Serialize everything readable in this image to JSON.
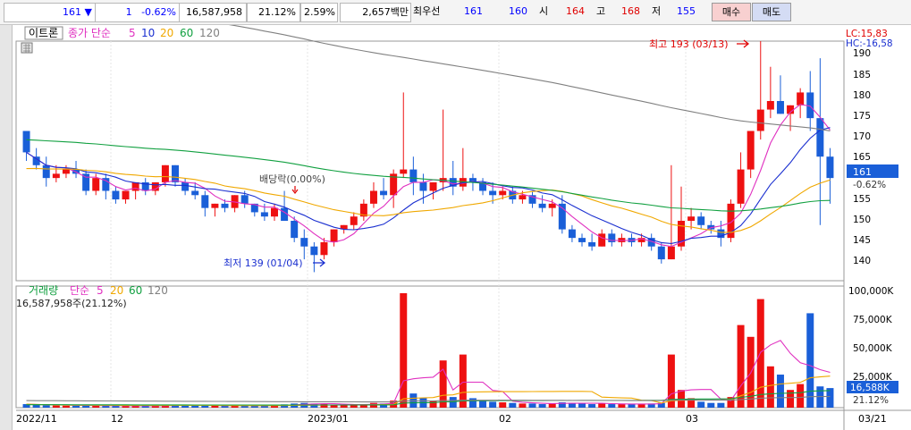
{
  "quote": {
    "price": "161",
    "direction_icon": "down-triangle",
    "change": "1",
    "change_pct": "-0.62%",
    "volume": "16,587,958",
    "volume_ratio": "21.12%",
    "turnover": "2.59%",
    "amount": "2,657백만",
    "hoga_label": "최우선",
    "ask": "161",
    "bid": "160",
    "open_label": "시",
    "open": "164",
    "high_label": "고",
    "high": "168",
    "low_label": "저",
    "low": "155",
    "buy_label": "매수",
    "sell_label": "매도"
  },
  "legend": {
    "item": "이트론",
    "price_ma_label": "종가 단순",
    "ma_periods": [
      "5",
      "10",
      "20",
      "60",
      "120"
    ],
    "volume_label": "거래량",
    "volume_ma_label": "단순",
    "volume_periods": [
      "5",
      "20",
      "60",
      "120"
    ],
    "volume_value": "16,587,958주(21.12%)"
  },
  "colors": {
    "up": "#ee1111",
    "down": "#1a5fd8",
    "ma5": "#e030c0",
    "ma10": "#1a2fd0",
    "ma20": "#f0a800",
    "ma60": "#11a040",
    "ma120": "#808080"
  },
  "annotations": {
    "high": "최고 193 (03/13)",
    "low": "최저 139 (01/04)",
    "dividend": "배당락(0.00%)"
  },
  "right_labels": {
    "lc": "LC:15,83",
    "hc": "HC:-16,58",
    "current_price": "161",
    "current_pct": "-0.62%",
    "current_volume": "16,588K",
    "volume_pct": "21.12%"
  },
  "price_axis": {
    "ticks": [
      "190",
      "185",
      "180",
      "175",
      "170",
      "165",
      "155",
      "150",
      "145",
      "140"
    ]
  },
  "volume_axis": {
    "ticks": [
      "100,000K",
      "75,000K",
      "50,000K",
      "25,000K"
    ]
  },
  "x_axis": {
    "labels": [
      "2022/11",
      "12",
      "2023/01",
      "02",
      "03",
      "03/21"
    ]
  },
  "chart_data": {
    "type": "candlestick",
    "ohlc": [
      [
        172,
        172,
        165,
        167
      ],
      [
        166,
        168,
        163,
        164
      ],
      [
        164,
        166,
        159,
        161
      ],
      [
        161,
        164,
        160,
        162
      ],
      [
        162,
        164,
        161,
        163
      ],
      [
        163,
        165,
        161,
        162
      ],
      [
        162,
        163,
        157,
        158
      ],
      [
        158,
        162,
        157,
        161
      ],
      [
        161,
        162,
        156,
        158
      ],
      [
        158,
        159,
        155,
        156
      ],
      [
        156,
        158,
        155,
        158
      ],
      [
        158,
        160,
        156,
        160
      ],
      [
        160,
        161,
        157,
        158
      ],
      [
        158,
        160,
        157,
        160
      ],
      [
        160,
        164,
        159,
        164
      ],
      [
        164,
        164,
        159,
        160
      ],
      [
        160,
        161,
        157,
        158
      ],
      [
        158,
        160,
        156,
        157
      ],
      [
        157,
        158,
        152,
        154
      ],
      [
        154,
        155,
        152,
        155
      ],
      [
        155,
        156,
        153,
        154
      ],
      [
        154,
        157,
        153,
        157
      ],
      [
        157,
        158,
        154,
        155
      ],
      [
        155,
        155,
        152,
        153
      ],
      [
        153,
        155,
        151,
        152
      ],
      [
        152,
        155,
        151,
        154
      ],
      [
        154,
        158,
        151,
        151
      ],
      [
        151,
        152,
        146,
        147
      ],
      [
        147,
        149,
        142,
        145
      ],
      [
        145,
        146,
        139,
        143
      ],
      [
        143,
        147,
        142,
        146
      ],
      [
        146,
        149,
        145,
        149
      ],
      [
        149,
        150,
        148,
        150
      ],
      [
        150,
        153,
        149,
        152
      ],
      [
        152,
        156,
        151,
        155
      ],
      [
        155,
        160,
        154,
        158
      ],
      [
        158,
        161,
        156,
        157
      ],
      [
        157,
        163,
        154,
        162
      ],
      [
        162,
        181,
        161,
        163
      ],
      [
        163,
        166,
        157,
        160
      ],
      [
        160,
        162,
        155,
        158
      ],
      [
        158,
        160,
        156,
        160
      ],
      [
        160,
        177,
        158,
        161
      ],
      [
        161,
        165,
        157,
        159
      ],
      [
        159,
        168,
        158,
        161
      ],
      [
        161,
        162,
        158,
        160
      ],
      [
        160,
        161,
        157,
        158
      ],
      [
        158,
        160,
        155,
        157
      ],
      [
        157,
        159,
        156,
        158
      ],
      [
        158,
        159,
        155,
        156
      ],
      [
        156,
        158,
        155,
        157
      ],
      [
        157,
        158,
        154,
        155
      ],
      [
        155,
        157,
        153,
        154
      ],
      [
        154,
        156,
        152,
        155
      ],
      [
        155,
        157,
        148,
        149
      ],
      [
        149,
        150,
        146,
        147
      ],
      [
        147,
        148,
        145,
        146
      ],
      [
        146,
        148,
        144,
        145
      ],
      [
        145,
        149,
        145,
        148
      ],
      [
        148,
        149,
        145,
        146
      ],
      [
        146,
        148,
        145,
        147
      ],
      [
        147,
        148,
        145,
        146
      ],
      [
        146,
        148,
        145,
        147
      ],
      [
        147,
        148,
        144,
        145
      ],
      [
        145,
        146,
        141,
        142
      ],
      [
        142,
        164,
        142,
        145
      ],
      [
        145,
        159,
        144,
        151
      ],
      [
        151,
        154,
        149,
        152
      ],
      [
        152,
        153,
        149,
        150
      ],
      [
        150,
        151,
        148,
        149
      ],
      [
        149,
        151,
        145,
        147
      ],
      [
        147,
        156,
        146,
        155
      ],
      [
        155,
        167,
        154,
        163
      ],
      [
        163,
        172,
        161,
        172
      ],
      [
        172,
        193,
        170,
        177
      ],
      [
        177,
        187,
        175,
        179
      ],
      [
        179,
        185,
        176,
        176
      ],
      [
        176,
        178,
        172,
        178
      ],
      [
        178,
        182,
        175,
        181
      ],
      [
        181,
        186,
        172,
        175
      ],
      [
        175,
        189,
        150,
        166
      ],
      [
        166,
        168,
        155,
        161
      ]
    ],
    "volume_k": [
      3000,
      2500,
      2000,
      1800,
      1700,
      1600,
      2200,
      1800,
      1600,
      1500,
      1400,
      1500,
      1600,
      1500,
      2500,
      2000,
      1700,
      1600,
      2200,
      1800,
      1600,
      1900,
      1700,
      1800,
      1800,
      1900,
      2800,
      3500,
      4000,
      3500,
      3000,
      2500,
      2200,
      2500,
      3000,
      4000,
      3500,
      6000,
      97000,
      12000,
      8000,
      6000,
      40000,
      9000,
      45000,
      8000,
      6000,
      5000,
      4500,
      4000,
      3500,
      3500,
      3000,
      3500,
      4500,
      4000,
      3500,
      3000,
      3500,
      3000,
      3000,
      3000,
      3000,
      3500,
      4000,
      45000,
      15000,
      8000,
      5000,
      4000,
      4000,
      9000,
      70000,
      60000,
      92000,
      35000,
      28000,
      15000,
      20000,
      80000,
      18000,
      16588
    ],
    "ylim": [
      137,
      193
    ],
    "volume_max_k": 100000
  }
}
